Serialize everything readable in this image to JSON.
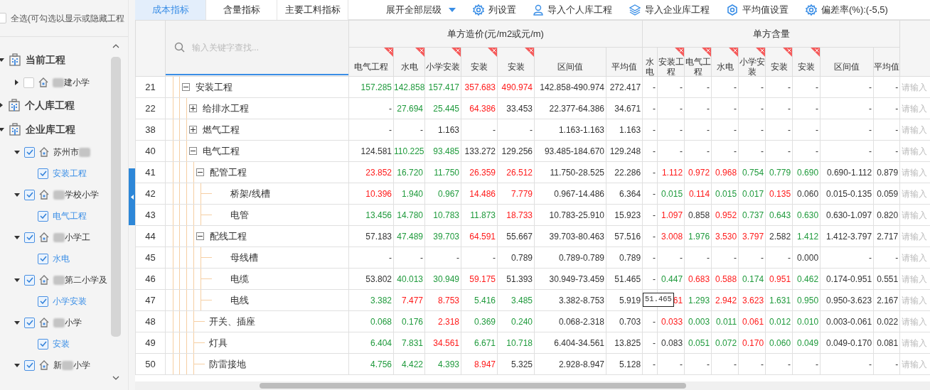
{
  "sidebar": {
    "select_all": {
      "label": "全选(可勾选以显示或隐藏工程",
      "checked": false
    },
    "groups": [
      {
        "title": "当前工程",
        "expanded": true,
        "projects": [
          {
            "expanded": false,
            "checked": false,
            "name_parts": [
              {
                "kind": "blur"
              },
              {
                "kind": "text",
                "text": "建小学"
              }
            ]
          }
        ]
      },
      {
        "title": "个人库工程",
        "expanded": false
      },
      {
        "title": "企业库工程",
        "expanded": true,
        "projects": [
          {
            "expanded": true,
            "checked": true,
            "name_parts": [
              {
                "kind": "text",
                "text": "苏州市"
              },
              {
                "kind": "blur"
              }
            ],
            "children": [
              {
                "name": "安装工程",
                "checked": true
              }
            ]
          },
          {
            "expanded": true,
            "checked": true,
            "name_parts": [
              {
                "kind": "blur"
              },
              {
                "kind": "text",
                "text": "学校小学"
              }
            ],
            "children": [
              {
                "name": "电气工程",
                "checked": true
              }
            ]
          },
          {
            "expanded": true,
            "checked": true,
            "name_parts": [
              {
                "kind": "blur"
              },
              {
                "kind": "text",
                "text": "小学工"
              }
            ],
            "children": [
              {
                "name": "水电",
                "checked": true
              }
            ]
          },
          {
            "expanded": true,
            "checked": true,
            "name_parts": [
              {
                "kind": "blur"
              },
              {
                "kind": "text",
                "text": "第二小学及"
              }
            ],
            "children": [
              {
                "name": "小学安装",
                "checked": true
              }
            ]
          },
          {
            "expanded": true,
            "checked": true,
            "name_parts": [
              {
                "kind": "blur"
              },
              {
                "kind": "text",
                "text": "小学"
              }
            ],
            "children": [
              {
                "name": "安装",
                "checked": true
              }
            ]
          },
          {
            "expanded": true,
            "checked": true,
            "name_parts": [
              {
                "kind": "text",
                "text": "新"
              },
              {
                "kind": "blur"
              },
              {
                "kind": "text",
                "text": "小学"
              }
            ]
          }
        ]
      }
    ]
  },
  "tabs": [
    {
      "label": "成本指标",
      "selected": true
    },
    {
      "label": "含量指标",
      "selected": false
    },
    {
      "label": "主要工料指标",
      "selected": false
    }
  ],
  "toolbar": [
    {
      "kind": "dropdown",
      "label": "展开全部层级"
    },
    {
      "kind": "gear",
      "label": "列设置"
    },
    {
      "kind": "person",
      "label": "导入个人库工程"
    },
    {
      "kind": "layers",
      "label": "导入企业库工程"
    },
    {
      "kind": "hexagon",
      "label": "平均值设置"
    },
    {
      "kind": "gear",
      "label": "偏差率(%):(-5,5)"
    }
  ],
  "table": {
    "search": {
      "placeholder": "输入关键字查找..."
    },
    "cost_group": {
      "title": "单方造价(元/m2或元/m)",
      "columns": [
        {
          "label": "电气工程",
          "removable": true
        },
        {
          "label": "水电",
          "removable": true
        },
        {
          "label": "小学安装",
          "removable": true
        },
        {
          "label": "安装",
          "removable": true
        },
        {
          "label": "安装",
          "removable": true
        },
        {
          "label": "区间值",
          "removable": false
        },
        {
          "label": "平均值",
          "removable": false
        }
      ]
    },
    "qty_group": {
      "title": "单方含量",
      "columns": [
        {
          "label": "水电",
          "removable": false
        },
        {
          "label": "安装工程",
          "removable": true
        },
        {
          "label": "电气工程",
          "removable": true
        },
        {
          "label": "水电",
          "removable": true
        },
        {
          "label": "小学安装",
          "removable": true
        },
        {
          "label": "安装",
          "removable": true
        },
        {
          "label": "安装",
          "removable": true
        },
        {
          "label": "区间值",
          "removable": false
        },
        {
          "label": "平均值",
          "removable": false
        }
      ]
    },
    "rows": [
      {
        "no": "21",
        "name": "安装工程",
        "expanded": true,
        "placeholder": "请输入",
        "cost": [
          {
            "text": "157.285",
            "color": "#1f9a3c"
          },
          {
            "text": "142.858",
            "color": "#1f9a3c"
          },
          {
            "text": "157.417",
            "color": "#1f9a3c"
          },
          {
            "text": "357.683",
            "color": "#ff1a1a"
          },
          {
            "text": "490.974",
            "color": "#ff1a1a"
          },
          {
            "text": "142.858-490.974"
          },
          {
            "text": "272.417"
          }
        ],
        "qty": [
          {
            "text": "-"
          },
          {
            "text": "-"
          },
          {
            "text": "-"
          },
          {
            "text": "-"
          },
          {
            "text": "-"
          },
          {
            "text": "-"
          },
          {
            "text": "-"
          },
          {
            "text": "-"
          },
          {
            "text": "-"
          }
        ],
        "children": [
          {
            "no": "22",
            "name": "给排水工程",
            "expanded": false,
            "placeholder": "请输入",
            "cost": [
              {
                "text": "-"
              },
              {
                "text": "27.694",
                "color": "#1f9a3c"
              },
              {
                "text": "25.445",
                "color": "#1f9a3c"
              },
              {
                "text": "64.386",
                "color": "#ff1a1a"
              },
              {
                "text": "33.453"
              },
              {
                "text": "22.377-64.386"
              },
              {
                "text": "34.671"
              }
            ],
            "qty": [
              {
                "text": "-"
              },
              {
                "text": "-"
              },
              {
                "text": "-"
              },
              {
                "text": "-"
              },
              {
                "text": "-"
              },
              {
                "text": "-"
              },
              {
                "text": "-"
              },
              {
                "text": "-"
              },
              {
                "text": "-"
              }
            ]
          },
          {
            "no": "38",
            "name": "燃气工程",
            "expanded": false,
            "placeholder": "请输入",
            "cost": [
              {
                "text": "-"
              },
              {
                "text": "-"
              },
              {
                "text": "1.163"
              },
              {
                "text": "-"
              },
              {
                "text": "-"
              },
              {
                "text": "1.163-1.163"
              },
              {
                "text": "1.163"
              }
            ],
            "qty": [
              {
                "text": "-"
              },
              {
                "text": "-"
              },
              {
                "text": "-"
              },
              {
                "text": "-"
              },
              {
                "text": "-"
              },
              {
                "text": "-"
              },
              {
                "text": "-"
              },
              {
                "text": "-"
              },
              {
                "text": "-"
              }
            ]
          },
          {
            "no": "40",
            "name": "电气工程",
            "expanded": true,
            "placeholder": "请输入",
            "cost": [
              {
                "text": "124.581"
              },
              {
                "text": "110.225",
                "color": "#1f9a3c"
              },
              {
                "text": "93.485",
                "color": "#1f9a3c"
              },
              {
                "text": "133.272"
              },
              {
                "text": "129.256"
              },
              {
                "text": "93.485-184.670"
              },
              {
                "text": "129.248"
              }
            ],
            "qty": [
              {
                "text": "-"
              },
              {
                "text": "-"
              },
              {
                "text": "-"
              },
              {
                "text": "-"
              },
              {
                "text": "-"
              },
              {
                "text": "-"
              },
              {
                "text": "-"
              },
              {
                "text": "-"
              },
              {
                "text": "-"
              }
            ],
            "children": [
              {
                "no": "41",
                "name": "配管工程",
                "expanded": true,
                "placeholder": "请输入",
                "cost": [
                  {
                    "text": "23.852",
                    "color": "#ff1a1a"
                  },
                  {
                    "text": "16.720",
                    "color": "#1f9a3c"
                  },
                  {
                    "text": "11.750",
                    "color": "#1f9a3c"
                  },
                  {
                    "text": "26.359",
                    "color": "#ff1a1a"
                  },
                  {
                    "text": "26.512",
                    "color": "#ff1a1a"
                  },
                  {
                    "text": "11.750-28.525"
                  },
                  {
                    "text": "22.286"
                  }
                ],
                "qty": [
                  {
                    "text": "-"
                  },
                  {
                    "text": "1.112",
                    "color": "#ff1a1a"
                  },
                  {
                    "text": "0.972",
                    "color": "#ff1a1a"
                  },
                  {
                    "text": "0.968",
                    "color": "#ff1a1a"
                  },
                  {
                    "text": "0.754",
                    "color": "#1f9a3c"
                  },
                  {
                    "text": "0.779",
                    "color": "#1f9a3c"
                  },
                  {
                    "text": "0.690",
                    "color": "#1f9a3c"
                  },
                  {
                    "text": "0.690-1.112"
                  },
                  {
                    "text": "0.879"
                  }
                ],
                "children": [
                  {
                    "no": "42",
                    "name": "桥架/线槽",
                    "placeholder": "请输入",
                    "cost": [
                      {
                        "text": "10.396",
                        "color": "#ff1a1a"
                      },
                      {
                        "text": "1.940",
                        "color": "#1f9a3c"
                      },
                      {
                        "text": "0.967",
                        "color": "#1f9a3c"
                      },
                      {
                        "text": "14.486",
                        "color": "#ff1a1a"
                      },
                      {
                        "text": "7.779",
                        "color": "#ff1a1a"
                      },
                      {
                        "text": "0.967-14.486"
                      },
                      {
                        "text": "6.364"
                      }
                    ],
                    "qty": [
                      {
                        "text": "-"
                      },
                      {
                        "text": "0.015",
                        "color": "#1f9a3c"
                      },
                      {
                        "text": "0.114",
                        "color": "#ff1a1a"
                      },
                      {
                        "text": "0.015",
                        "color": "#1f9a3c"
                      },
                      {
                        "text": "0.017",
                        "color": "#1f9a3c"
                      },
                      {
                        "text": "0.135",
                        "color": "#ff1a1a"
                      },
                      {
                        "text": "0.060"
                      },
                      {
                        "text": "0.015-0.135"
                      },
                      {
                        "text": "0.059"
                      }
                    ]
                  },
                  {
                    "no": "43",
                    "name": "电管",
                    "placeholder": "请输入",
                    "cost": [
                      {
                        "text": "13.456",
                        "color": "#1f9a3c"
                      },
                      {
                        "text": "14.780",
                        "color": "#1f9a3c"
                      },
                      {
                        "text": "10.783",
                        "color": "#1f9a3c"
                      },
                      {
                        "text": "11.873",
                        "color": "#1f9a3c"
                      },
                      {
                        "text": "18.733",
                        "color": "#ff1a1a"
                      },
                      {
                        "text": "10.783-25.910"
                      },
                      {
                        "text": "15.923"
                      }
                    ],
                    "qty": [
                      {
                        "text": "-"
                      },
                      {
                        "text": "1.097",
                        "color": "#ff1a1a"
                      },
                      {
                        "text": "0.858"
                      },
                      {
                        "text": "0.952",
                        "color": "#ff1a1a"
                      },
                      {
                        "text": "0.737",
                        "color": "#1f9a3c"
                      },
                      {
                        "text": "0.643",
                        "color": "#1f9a3c"
                      },
                      {
                        "text": "0.630",
                        "color": "#1f9a3c"
                      },
                      {
                        "text": "0.630-1.097"
                      },
                      {
                        "text": "0.820"
                      }
                    ]
                  }
                ]
              },
              {
                "no": "44",
                "name": "配线工程",
                "expanded": true,
                "placeholder": "请输入",
                "cost": [
                  {
                    "text": "57.183"
                  },
                  {
                    "text": "47.489",
                    "color": "#1f9a3c"
                  },
                  {
                    "text": "39.703",
                    "color": "#1f9a3c"
                  },
                  {
                    "text": "64.591",
                    "color": "#ff1a1a"
                  },
                  {
                    "text": "55.667"
                  },
                  {
                    "text": "39.703-80.463"
                  },
                  {
                    "text": "57.516"
                  }
                ],
                "qty": [
                  {
                    "text": "-"
                  },
                  {
                    "text": "3.008",
                    "color": "#ff1a1a"
                  },
                  {
                    "text": "1.976",
                    "color": "#1f9a3c"
                  },
                  {
                    "text": "3.530",
                    "color": "#ff1a1a"
                  },
                  {
                    "text": "3.797",
                    "color": "#ff1a1a"
                  },
                  {
                    "text": "2.582"
                  },
                  {
                    "text": "1.412",
                    "color": "#1f9a3c"
                  },
                  {
                    "text": "1.412-3.797"
                  },
                  {
                    "text": "2.717"
                  }
                ],
                "children": [
                  {
                    "no": "45",
                    "name": "母线槽",
                    "placeholder": "请输入",
                    "cost": [
                      {
                        "text": "-"
                      },
                      {
                        "text": "-"
                      },
                      {
                        "text": "-"
                      },
                      {
                        "text": "-"
                      },
                      {
                        "text": "0.789"
                      },
                      {
                        "text": "0.789-0.789"
                      },
                      {
                        "text": "0.789"
                      }
                    ],
                    "qty": [
                      {
                        "text": "-"
                      },
                      {
                        "text": "-"
                      },
                      {
                        "text": "-"
                      },
                      {
                        "text": "-"
                      },
                      {
                        "text": "-"
                      },
                      {
                        "text": "-"
                      },
                      {
                        "text": "0.000"
                      },
                      {
                        "text": "-"
                      },
                      {
                        "text": "-"
                      }
                    ]
                  },
                  {
                    "no": "46",
                    "name": "电缆",
                    "placeholder": "请输入",
                    "cost": [
                      {
                        "text": "53.802"
                      },
                      {
                        "text": "40.013",
                        "color": "#1f9a3c"
                      },
                      {
                        "text": "30.949",
                        "color": "#1f9a3c"
                      },
                      {
                        "text": "59.175",
                        "color": "#ff1a1a"
                      },
                      {
                        "text": "51.393"
                      },
                      {
                        "text": "30.949-73.459"
                      },
                      {
                        "text": "51.465"
                      }
                    ],
                    "qty": [
                      {
                        "text": "-"
                      },
                      {
                        "text": "0.447",
                        "color": "#1f9a3c"
                      },
                      {
                        "text": "0.683",
                        "color": "#ff1a1a"
                      },
                      {
                        "text": "0.588",
                        "color": "#ff1a1a"
                      },
                      {
                        "text": "0.174",
                        "color": "#1f9a3c"
                      },
                      {
                        "text": "0.951",
                        "color": "#ff1a1a"
                      },
                      {
                        "text": "0.462",
                        "color": "#1f9a3c"
                      },
                      {
                        "text": "0.174-0.951"
                      },
                      {
                        "text": "0.551"
                      }
                    ]
                  },
                  {
                    "no": "47",
                    "name": "电线",
                    "placeholder": "请输入",
                    "tooltip": {
                      "text": "51.465"
                    },
                    "cost": [
                      {
                        "text": "3.382",
                        "color": "#1f9a3c"
                      },
                      {
                        "text": "7.477",
                        "color": "#ff1a1a"
                      },
                      {
                        "text": "8.753",
                        "color": "#ff1a1a"
                      },
                      {
                        "text": "5.416",
                        "color": "#1f9a3c"
                      },
                      {
                        "text": "3.485",
                        "color": "#1f9a3c"
                      },
                      {
                        "text": "3.382-8.753"
                      },
                      {
                        "text": "5.919"
                      }
                    ],
                    "qty": [
                      {
                        "text": "61",
                        "color": "#ff1a1a"
                      },
                      {
                        "text": "1.293",
                        "color": "#1f9a3c"
                      },
                      {
                        "text": "2.942",
                        "color": "#ff1a1a"
                      },
                      {
                        "text": "3.623",
                        "color": "#ff1a1a"
                      },
                      {
                        "text": "1.631",
                        "color": "#1f9a3c"
                      },
                      {
                        "text": "0.950",
                        "color": "#1f9a3c"
                      },
                      {
                        "text": "0.950-3.623"
                      },
                      {
                        "text": "2.167"
                      }
                    ]
                  }
                ]
              },
              {
                "no": "48",
                "name": "开关、插座",
                "placeholder": "请输入",
                "cost": [
                  {
                    "text": "0.068",
                    "color": "#1f9a3c"
                  },
                  {
                    "text": "0.176",
                    "color": "#1f9a3c"
                  },
                  {
                    "text": "2.318",
                    "color": "#ff1a1a"
                  },
                  {
                    "text": "0.369",
                    "color": "#1f9a3c"
                  },
                  {
                    "text": "0.240",
                    "color": "#1f9a3c"
                  },
                  {
                    "text": "0.068-2.318"
                  },
                  {
                    "text": "0.703"
                  }
                ],
                "qty": [
                  {
                    "text": "-"
                  },
                  {
                    "text": "0.033",
                    "color": "#ff1a1a"
                  },
                  {
                    "text": "0.003",
                    "color": "#1f9a3c"
                  },
                  {
                    "text": "0.011",
                    "color": "#1f9a3c"
                  },
                  {
                    "text": "0.061",
                    "color": "#ff1a1a"
                  },
                  {
                    "text": "0.012",
                    "color": "#1f9a3c"
                  },
                  {
                    "text": "0.010",
                    "color": "#1f9a3c"
                  },
                  {
                    "text": "0.003-0.061"
                  },
                  {
                    "text": "0.022"
                  }
                ]
              },
              {
                "no": "49",
                "name": "灯具",
                "placeholder": "请输入",
                "cost": [
                  {
                    "text": "6.404",
                    "color": "#1f9a3c"
                  },
                  {
                    "text": "7.831",
                    "color": "#1f9a3c"
                  },
                  {
                    "text": "34.561",
                    "color": "#ff1a1a"
                  },
                  {
                    "text": "6.671",
                    "color": "#1f9a3c"
                  },
                  {
                    "text": "10.718",
                    "color": "#1f9a3c"
                  },
                  {
                    "text": "6.404-34.561"
                  },
                  {
                    "text": "13.825"
                  }
                ],
                "qty": [
                  {
                    "text": "-"
                  },
                  {
                    "text": "0.083"
                  },
                  {
                    "text": "0.051",
                    "color": "#1f9a3c"
                  },
                  {
                    "text": "0.072",
                    "color": "#1f9a3c"
                  },
                  {
                    "text": "0.170",
                    "color": "#ff1a1a"
                  },
                  {
                    "text": "0.060",
                    "color": "#1f9a3c"
                  },
                  {
                    "text": "0.049",
                    "color": "#1f9a3c"
                  },
                  {
                    "text": "0.049-0.170"
                  },
                  {
                    "text": "0.081"
                  }
                ]
              },
              {
                "no": "50",
                "name": "防雷接地",
                "placeholder": "请输入",
                "cost": [
                  {
                    "text": "4.756",
                    "color": "#1f9a3c"
                  },
                  {
                    "text": "4.422",
                    "color": "#1f9a3c"
                  },
                  {
                    "text": "4.393",
                    "color": "#1f9a3c"
                  },
                  {
                    "text": "8.947",
                    "color": "#ff1a1a"
                  },
                  {
                    "text": "5.325"
                  },
                  {
                    "text": "2.928-8.947"
                  },
                  {
                    "text": "5.128"
                  }
                ],
                "qty": [
                  {
                    "text": "-"
                  },
                  {
                    "text": "-"
                  },
                  {
                    "text": "-"
                  },
                  {
                    "text": "-"
                  },
                  {
                    "text": "-"
                  },
                  {
                    "text": "-"
                  },
                  {
                    "text": "-"
                  },
                  {
                    "text": "-"
                  },
                  {
                    "text": "-"
                  }
                ]
              }
            ]
          }
        ]
      }
    ]
  }
}
